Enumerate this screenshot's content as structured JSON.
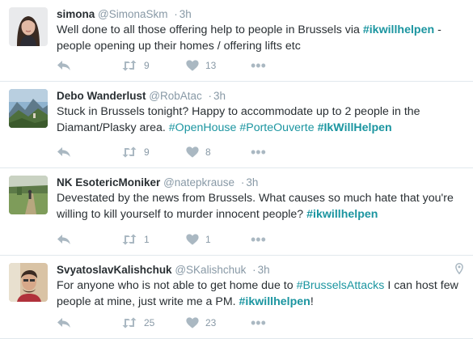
{
  "tweets": [
    {
      "name": "simona",
      "handle": "@SimonaSkm",
      "time": "3h",
      "text": [
        {
          "t": "Well done to all those offering help to people in Brussels via "
        },
        {
          "t": "#ikwillhelpen",
          "tag": true
        },
        {
          "t": " - people opening up their homes / offering lifts etc"
        }
      ],
      "retweets": "9",
      "likes": "13",
      "avatar": "avatar-woman"
    },
    {
      "name": "Debo Wanderlust",
      "handle": "@RobAtac",
      "time": "3h",
      "text": [
        {
          "t": "Stuck in Brussels tonight? Happy to accommodate up to 2 people in the Diamant/Plasky area. "
        },
        {
          "t": "#OpenHouse",
          "link": true
        },
        {
          "t": " "
        },
        {
          "t": "#PorteOuverte",
          "link": true
        },
        {
          "t": " "
        },
        {
          "t": "#IkWillHelpen",
          "tag": true
        }
      ],
      "retweets": "9",
      "likes": "8",
      "avatar": "avatar-mountains"
    },
    {
      "name": "NK EsotericMoniker",
      "handle": "@natepkrause",
      "time": "3h",
      "text": [
        {
          "t": "Devestated by the news from Brussels. What causes so much hate that you're willing to kill yourself to murder innocent people? "
        },
        {
          "t": "#ikwillhelpen",
          "tag": true
        }
      ],
      "retweets": "1",
      "likes": "1",
      "avatar": "avatar-field"
    },
    {
      "name": "SvyatoslavKalishchuk",
      "handle": "@SKalishchuk",
      "time": "3h",
      "text": [
        {
          "t": "For anyone who is not able to get home due to "
        },
        {
          "t": "#BrusselsAttacks",
          "link": true
        },
        {
          "t": " I can host few people at mine, just write me a PM. "
        },
        {
          "t": "#ikwillhelpen",
          "tag": true
        },
        {
          "t": "!"
        }
      ],
      "retweets": "25",
      "likes": "23",
      "avatar": "avatar-man",
      "geo_icon": "location-pin-icon"
    }
  ],
  "icons": {
    "reply": "reply-icon",
    "retweet": "retweet-icon",
    "like": "heart-icon",
    "more": "more-icon",
    "more_glyph": "•••"
  },
  "colors": {
    "hashtag": "#1b95a0",
    "muted": "#8899a6",
    "icon": "#aab8c2",
    "text": "#292f33",
    "divider": "#e1e8ed"
  }
}
